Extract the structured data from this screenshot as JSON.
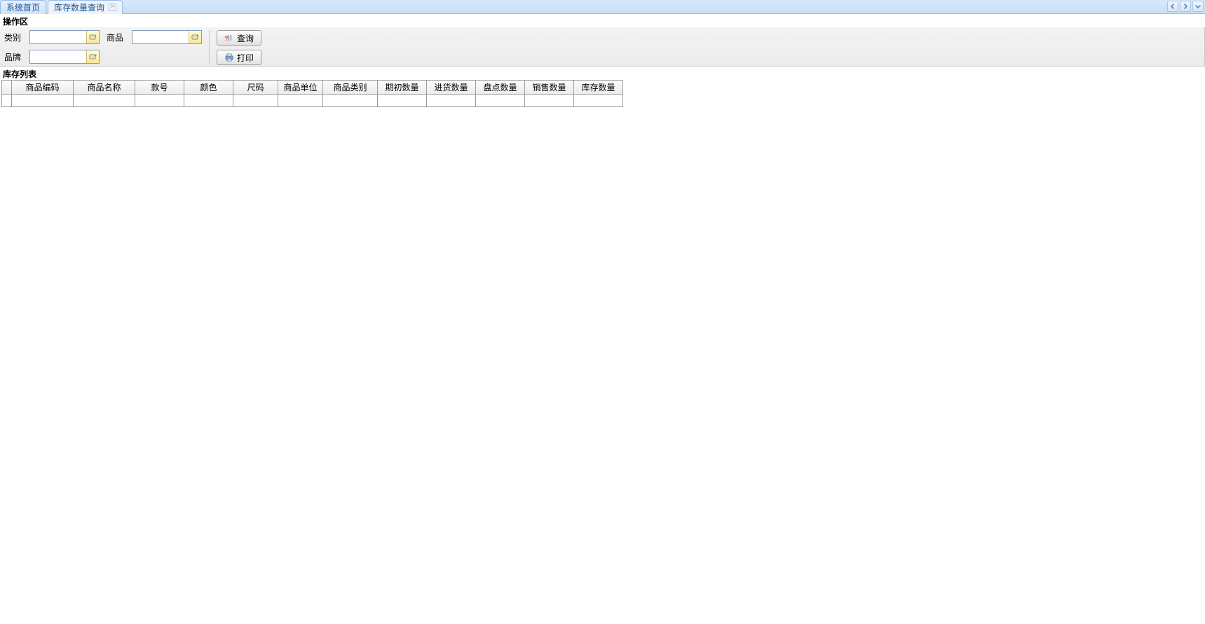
{
  "tabs": {
    "home": "系统首页",
    "active": "库存数量查询"
  },
  "section_operation": "操作区",
  "filters": {
    "category_label": "类别",
    "category_value": "",
    "product_label": "商品",
    "product_value": "",
    "brand_label": "品牌",
    "brand_value": ""
  },
  "actions": {
    "query": "查询",
    "print": "打印"
  },
  "section_list": "库存列表",
  "table": {
    "columns": [
      "商品编码",
      "商品名称",
      "款号",
      "颜色",
      "尺码",
      "商品单位",
      "商品类别",
      "期初数量",
      "进货数量",
      "盘点数量",
      "销售数量",
      "库存数量"
    ],
    "rows": [
      [
        "",
        "",
        "",
        "",
        "",
        "",
        "",
        "",
        "",
        "",
        "",
        ""
      ]
    ]
  }
}
